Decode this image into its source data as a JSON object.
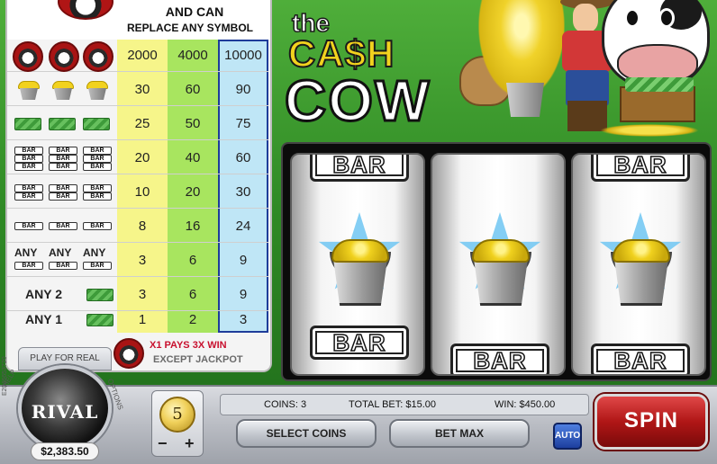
{
  "paytable": {
    "header_line1": "AND CAN",
    "header_line2": "REPLACE ANY SYMBOL",
    "rows": [
      {
        "symbol": "cow-logo x3",
        "values": [
          "2000",
          "4000",
          "10000"
        ]
      },
      {
        "symbol": "gold-bucket x3",
        "values": [
          "30",
          "60",
          "90"
        ]
      },
      {
        "symbol": "cash-stack x3",
        "values": [
          "25",
          "50",
          "75"
        ]
      },
      {
        "symbol": "triple-bar x3",
        "values": [
          "20",
          "40",
          "60"
        ]
      },
      {
        "symbol": "double-bar x3",
        "values": [
          "10",
          "20",
          "30"
        ]
      },
      {
        "symbol": "single-bar x3",
        "values": [
          "8",
          "16",
          "24"
        ]
      },
      {
        "symbol": "any-bar x3",
        "values": [
          "3",
          "6",
          "9"
        ]
      },
      {
        "symbol": "any 2 cash",
        "values": [
          "3",
          "6",
          "9"
        ]
      },
      {
        "symbol": "any 1 cash",
        "values": [
          "1",
          "2",
          "3"
        ]
      }
    ],
    "bar_label": "BAR",
    "any_label": "ANY",
    "any2_label": "ANY 2",
    "any1_label": "ANY 1",
    "footer_line1": "X1 PAYS 3X WIN",
    "footer_line2": "EXCEPT JACKPOT"
  },
  "title": {
    "line_the": "the",
    "line_cash": "CA$H",
    "line_cow": "COW"
  },
  "reels": [
    {
      "top": "BAR",
      "center": "gold-bucket",
      "bottom": "BAR"
    },
    {
      "top": "",
      "center": "gold-bucket",
      "bottom": "BAR"
    },
    {
      "top": "BAR",
      "center": "gold-bucket",
      "bottom": "BAR"
    }
  ],
  "controls": {
    "play_for_real": "PLAY FOR REAL",
    "brand": "RIVAL",
    "help_label": "HELP",
    "options_label": "OPTIONS",
    "balance": "$2,383.50",
    "coin_value": "5",
    "minus": "−",
    "plus": "+",
    "coins": "COINS: 3",
    "total_bet": "TOTAL BET: $15.00",
    "win": "WIN: $450.00",
    "select_coins": "SELECT COINS",
    "bet_max": "BET MAX",
    "auto": "AUTO",
    "spin": "SPIN",
    "serial": "E2046653720"
  },
  "colors": {
    "col1": "#f6f58a",
    "col2": "#a8e55f",
    "col3": "#bfe6f6",
    "spin": "#b01616",
    "auto": "#1d3f9e"
  }
}
